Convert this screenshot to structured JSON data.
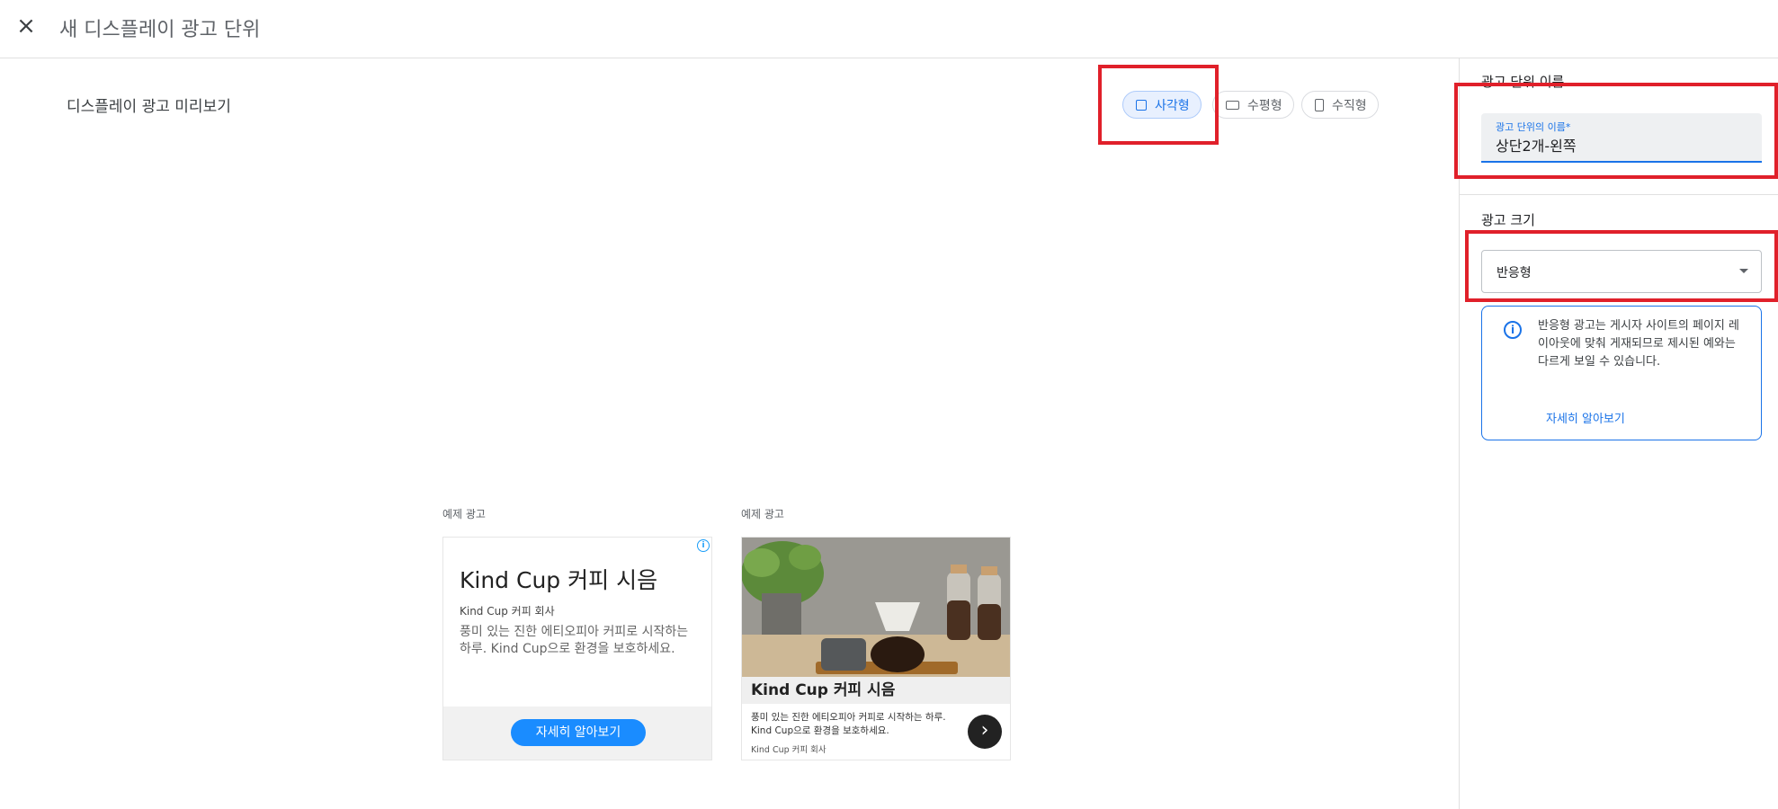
{
  "header": {
    "close_icon": "×",
    "title": "새 디스플레이 광고 단위"
  },
  "preview": {
    "title": "디스플레이 광고 미리보기",
    "shapes": [
      {
        "label": "사각형",
        "icon": "square-icon",
        "selected": true
      },
      {
        "label": "수평형",
        "icon": "horizontal-rect-icon",
        "selected": false
      },
      {
        "label": "수직형",
        "icon": "vertical-rect-icon",
        "selected": false
      }
    ]
  },
  "samples": [
    {
      "label": "예제 광고",
      "info_glyph": "i",
      "headline": "Kind Cup 커피 시음",
      "advertiser": "Kind Cup 커피 회사",
      "description": "풍미 있는 진한 에티오피아 커피로 시작하는 하루. Kind Cup으로 환경을 보호하세요.",
      "cta": "자세히 알아보기",
      "cta_color": "#1a8cff"
    },
    {
      "label": "예제 광고",
      "headline": "Kind Cup 커피 시음",
      "description": "풍미 있는 진한 에티오피아 커피로 시작하는 하루. Kind Cup으로 환경을 보호하세요.",
      "advertiser": "Kind Cup 커피 회사",
      "arrow_glyph": "›"
    }
  ],
  "sidebar": {
    "name_section": {
      "label": "광고 단위 이름",
      "field_label": "광고 단위의 이름*",
      "field_value": "상단2개-왼쪽"
    },
    "size_section": {
      "label": "광고 크기",
      "selected": "반응형",
      "info_glyph": "i",
      "info_text": "반응형 광고는 게시자 사이트의 페이지 레이아웃에 맞춰 게재되므로 제시된 예와는 다르게 보일 수 있습니다.",
      "learn_more": "자세히 알아보기"
    }
  },
  "colors": {
    "accent": "#1a73e8",
    "highlight_box": "#e0202a"
  }
}
